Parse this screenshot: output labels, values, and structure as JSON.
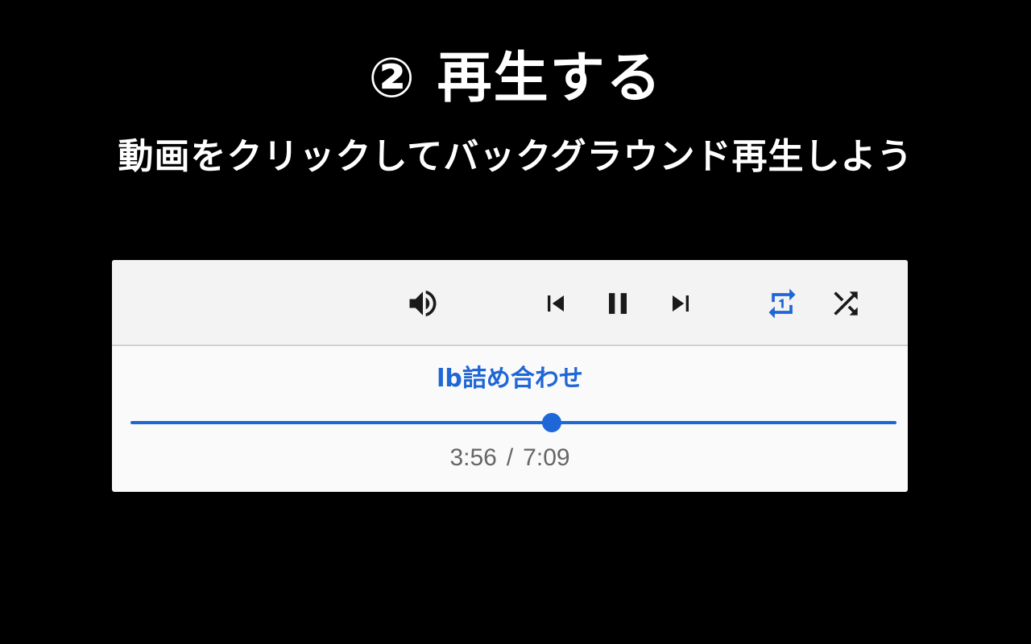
{
  "heading": {
    "title": "② 再生する",
    "subtitle": "動画をクリックしてバックグラウンド再生しよう"
  },
  "player": {
    "controls": {
      "volume": {
        "icon": "volume-up-icon"
      },
      "previous": {
        "icon": "skip-previous-icon"
      },
      "play_pause": {
        "icon": "pause-icon",
        "state": "playing"
      },
      "next": {
        "icon": "skip-next-icon"
      },
      "repeat": {
        "icon": "repeat-one-icon",
        "active": true
      },
      "shuffle": {
        "icon": "shuffle-icon",
        "active": false
      }
    },
    "track_title": "lb詰め合わせ",
    "progress": {
      "current": "3:56",
      "separator": "/",
      "duration": "7:09",
      "fraction": 0.5503
    },
    "colors": {
      "accent": "#1f66d6",
      "icon": "#1a1a1a",
      "time_text": "#666666"
    }
  }
}
